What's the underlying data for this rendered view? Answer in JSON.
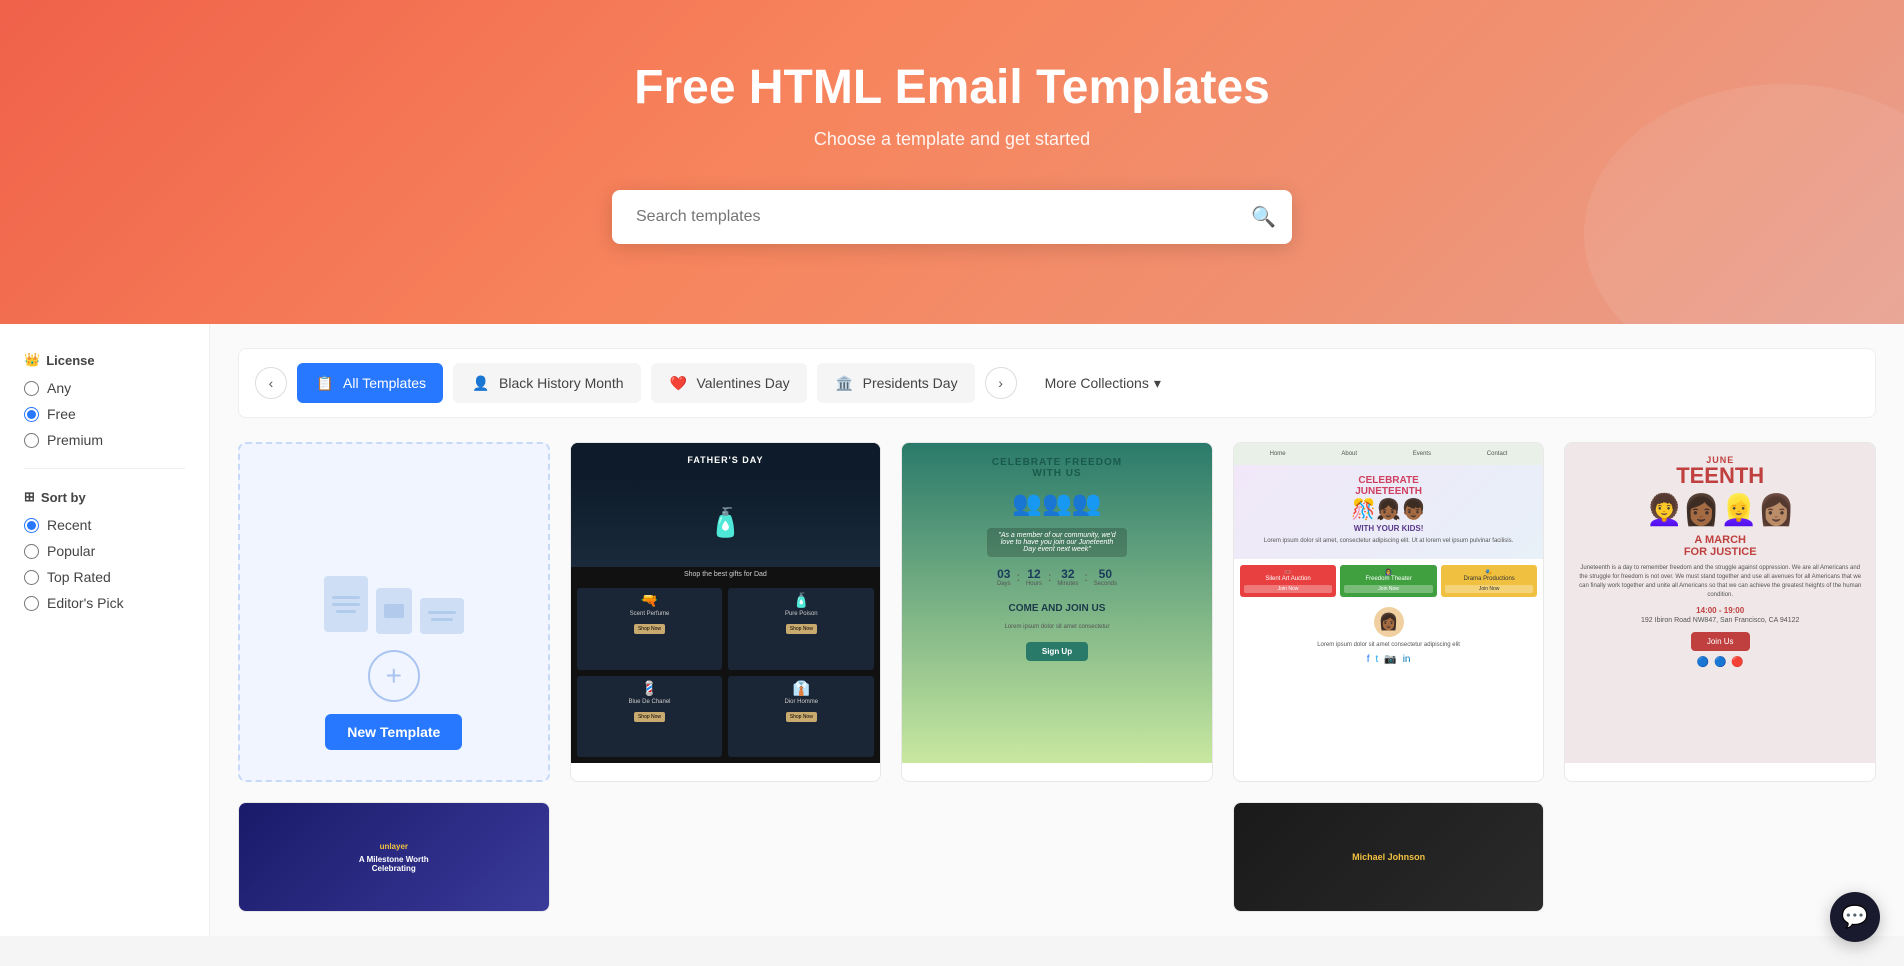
{
  "hero": {
    "title": "Free HTML Email Templates",
    "subtitle": "Choose a template and get started",
    "search_placeholder": "Search templates"
  },
  "sidebar": {
    "license_label": "License",
    "license_icon": "👑",
    "sort_label": "Sort by",
    "sort_icon": "⊞",
    "license_options": [
      {
        "label": "Any",
        "value": "any",
        "checked": false
      },
      {
        "label": "Free",
        "value": "free",
        "checked": true
      },
      {
        "label": "Premium",
        "value": "premium",
        "checked": false
      }
    ],
    "sort_options": [
      {
        "label": "Recent",
        "value": "recent",
        "checked": true
      },
      {
        "label": "Popular",
        "value": "popular",
        "checked": false
      },
      {
        "label": "Top Rated",
        "value": "top_rated",
        "checked": false
      },
      {
        "label": "Editor's Pick",
        "value": "editors_pick",
        "checked": false
      }
    ]
  },
  "collections": {
    "nav_prev_label": "‹",
    "nav_next_label": "›",
    "more_label": "More Collections",
    "items": [
      {
        "label": "All Templates",
        "active": true,
        "icon": "📋"
      },
      {
        "label": "Black History Month",
        "active": false,
        "icon": "👤"
      },
      {
        "label": "Valentines Day",
        "active": false,
        "icon": "❤️"
      },
      {
        "label": "Presidents Day",
        "active": false,
        "icon": "🏛️"
      }
    ]
  },
  "new_template": {
    "button_label": "New Template",
    "plus_icon": "+"
  },
  "templates": [
    {
      "id": "fathers-day",
      "type": "fathers-day"
    },
    {
      "id": "celebrate-freedom",
      "type": "celebrate-freedom"
    },
    {
      "id": "juneteenth",
      "type": "juneteenth"
    },
    {
      "id": "march-justice",
      "type": "march-justice"
    }
  ],
  "chat": {
    "icon": "💬"
  }
}
